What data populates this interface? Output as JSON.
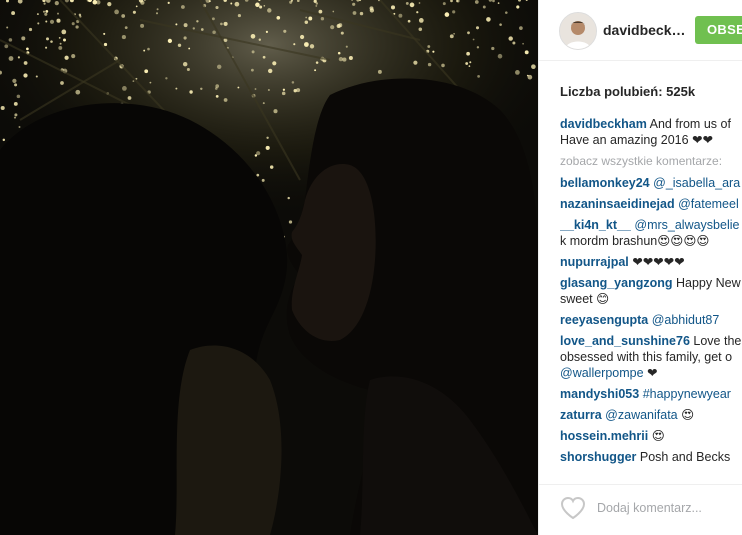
{
  "post": {
    "image_alt_icon": "kissing-couple-photo",
    "colors": {
      "follow_green": "#70c050",
      "link_blue": "#125688",
      "muted_gray": "#a5a7aa"
    }
  },
  "header": {
    "username": "davidbeck…",
    "follow_label": "OBSERWUJ"
  },
  "likes": {
    "label": "Liczba polubień: 525k"
  },
  "caption": {
    "author": "davidbeckham",
    "text": " And from us of",
    "text_line2": "Have an amazing 2016 ❤❤"
  },
  "view_all": "zobacz wszystkie komentarze:",
  "comments": [
    {
      "author": "bellamonkey24",
      "mention": "@_isabella_ara",
      "text": ""
    },
    {
      "author": "nazaninsaeidinejad",
      "mention": "@fatemeel",
      "text": ""
    },
    {
      "author": "__ki4n_kt__",
      "mention": "@mrs_alwaysbelie",
      "text": "",
      "line2": "k mordm brashun😍😍😍😍"
    },
    {
      "author": "nupurrajpal",
      "mention": "",
      "text": " ❤❤❤❤❤"
    },
    {
      "author": "glasang_yangzong",
      "mention": "",
      "text": " Happy New",
      "line2": "sweet 😊"
    },
    {
      "author": "reeyasengupta",
      "mention": "@abhidut87",
      "text": ""
    },
    {
      "author": "love_and_sunshine76",
      "mention": "",
      "text": " Love the",
      "line2": "obsessed with this family, get o",
      "line3_mention": "@wallerpompe",
      "line3_text": " ❤"
    },
    {
      "author": "mandyshi053",
      "mention": "#happynewyear",
      "text": ""
    },
    {
      "author": "zaturra",
      "mention": "@zawanifata",
      "text": " 😍"
    },
    {
      "author": "hossein.mehrii",
      "mention": "",
      "text": " 😍"
    },
    {
      "author": "shorshugger",
      "mention": "",
      "text": " Posh and Becks"
    }
  ],
  "footer": {
    "heart_icon": "heart-outline-icon",
    "comment_placeholder": "Dodaj komentarz..."
  }
}
